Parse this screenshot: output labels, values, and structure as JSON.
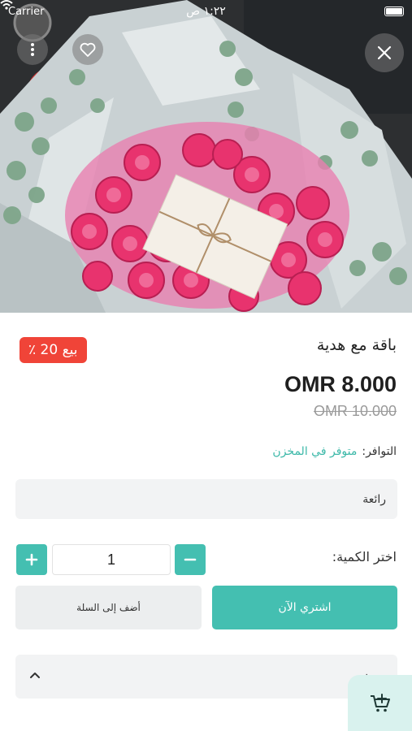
{
  "status_bar": {
    "carrier": "Carrier",
    "time": "١:٢٢ ص",
    "wifi_icon": "wifi-icon",
    "battery_icon": "battery-icon"
  },
  "hero": {
    "close_icon": "close-icon",
    "favorite_icon": "heart-icon",
    "more_icon": "more-vertical-icon"
  },
  "product": {
    "title": "باقة مع هدية",
    "sale_badge": "بيع 20 ٪",
    "price": "OMR 8.000",
    "old_price": "OMR 10.000",
    "availability_label": "التوافر:",
    "availability_value": "متوفر في المخزن"
  },
  "option": {
    "value": "رائعة"
  },
  "quantity": {
    "label": "اختر الكمية:",
    "value": "1",
    "increase_icon": "plus-icon",
    "decrease_icon": "minus-icon"
  },
  "actions": {
    "buy_now": "اشتري الآن",
    "add_to_cart": "أضف إلى السلة"
  },
  "description": {
    "label": "وصف",
    "chevron_icon": "chevron-up-icon"
  },
  "floating_cart": {
    "icon": "cart-add-icon"
  },
  "colors": {
    "accent": "#44bfb1",
    "sale": "#f04438",
    "availability": "#3bb8a8",
    "panel": "#f2f3f4"
  }
}
